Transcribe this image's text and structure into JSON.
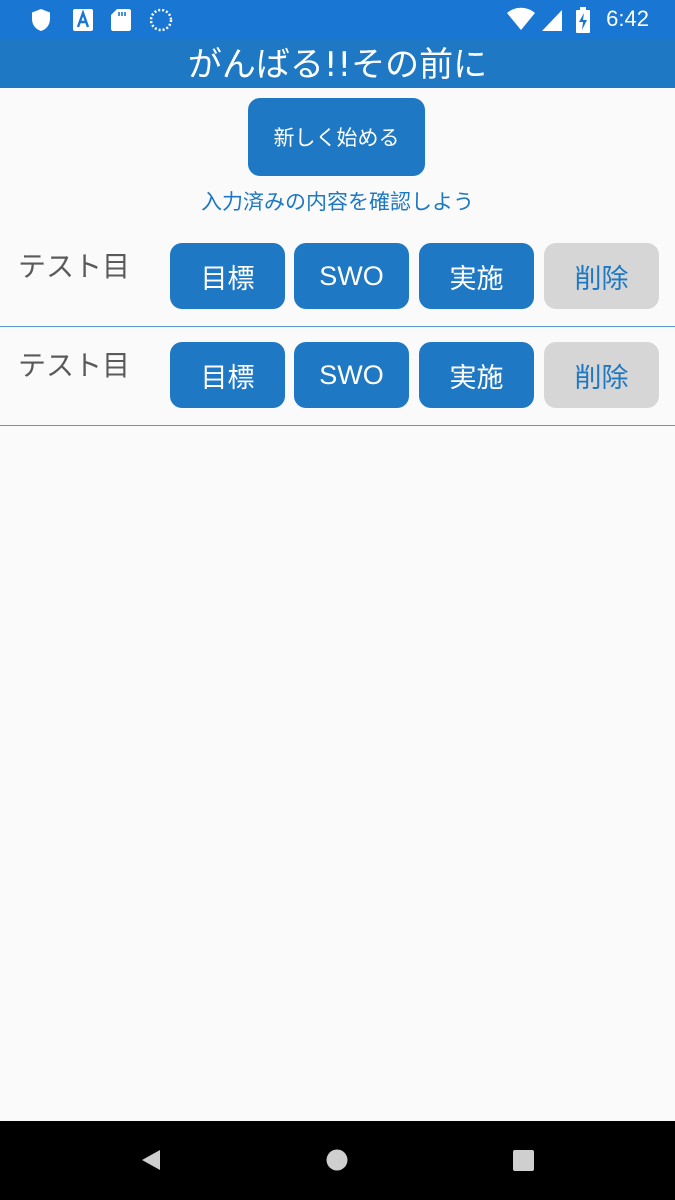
{
  "status_bar": {
    "time": "6:42",
    "left_icons": [
      "shield-icon",
      "font-a-icon",
      "sd-card-icon",
      "sync-circle-icon"
    ],
    "right_icons": [
      "wifi-icon",
      "signal-icon",
      "battery-charging-icon"
    ]
  },
  "app_bar": {
    "title": "がんばる!!その前に"
  },
  "main": {
    "new_button_label": "新しく始める",
    "hint": "入力済みの内容を確認しよう"
  },
  "rows": [
    {
      "label": "テスト目",
      "buttons": [
        "目標",
        "SWO",
        "実施"
      ],
      "delete_label": "削除"
    },
    {
      "label": "テスト目",
      "buttons": [
        "目標",
        "SWO",
        "実施"
      ],
      "delete_label": "削除"
    }
  ],
  "nav_bar": {
    "icons": [
      "back-icon",
      "home-icon",
      "recents-icon"
    ]
  },
  "colors": {
    "status_bar": "#1976d2",
    "accent": "#1e78c3",
    "delete_button": "#d6d6d6",
    "background": "#fafafa"
  }
}
